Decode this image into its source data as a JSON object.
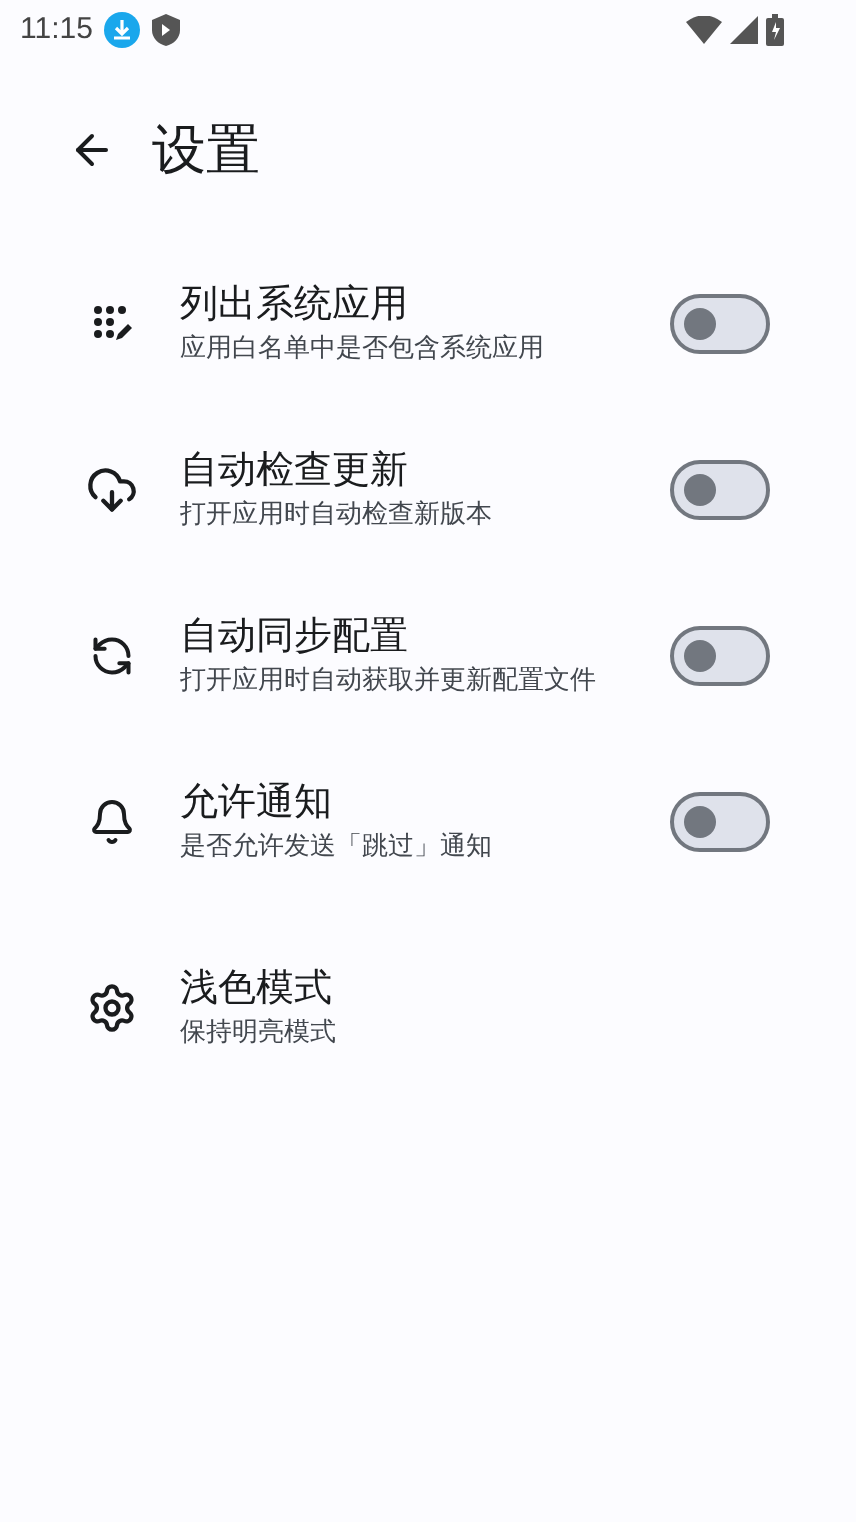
{
  "status_bar": {
    "time": "11:15"
  },
  "header": {
    "title": "设置"
  },
  "settings": [
    {
      "kind": "toggle",
      "title": "列出系统应用",
      "subtitle": "应用白名单中是否包含系统应用",
      "on": false
    },
    {
      "kind": "toggle",
      "title": "自动检查更新",
      "subtitle": "打开应用时自动检查新版本",
      "on": false
    },
    {
      "kind": "toggle",
      "title": "自动同步配置",
      "subtitle": "打开应用时自动获取并更新配置文件",
      "on": false
    },
    {
      "kind": "toggle",
      "title": "允许通知",
      "subtitle": "是否允许发送「跳过」通知",
      "on": false
    },
    {
      "kind": "plain",
      "title": "浅色模式",
      "subtitle": "保持明亮模式"
    }
  ]
}
